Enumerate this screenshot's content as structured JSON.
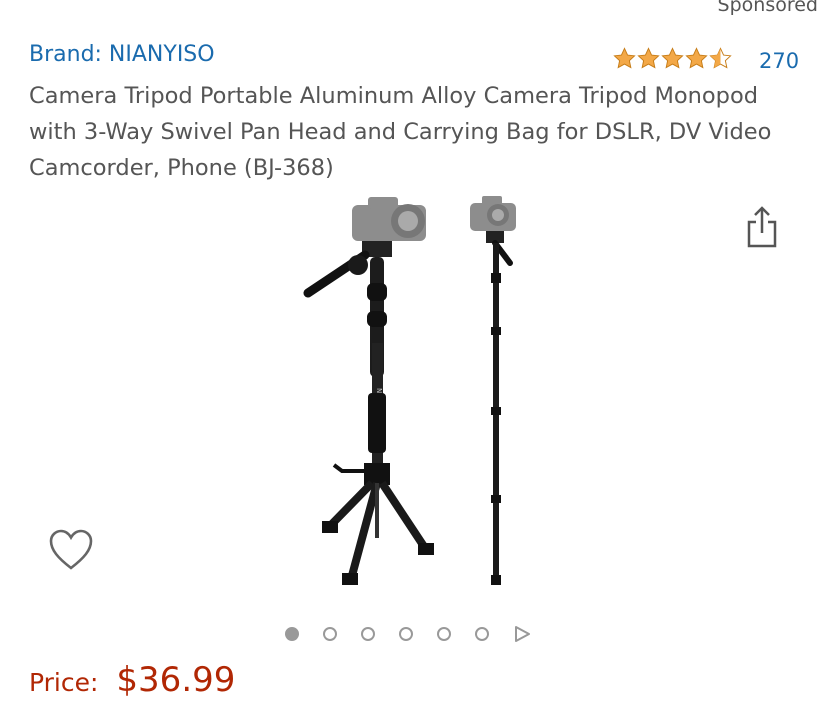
{
  "header": {
    "sponsored": "Sponsored"
  },
  "product": {
    "brand": "Brand: NIANYISO",
    "rating": {
      "stars": 4.5,
      "count": "270"
    },
    "title": "Camera Tripod Portable Aluminum Alloy Camera Tripod Monopod with 3-Way Swivel Pan Head and Carrying Bag for DSLR, DV Video Camcorder, Phone (BJ-368)",
    "price_label": "Price:",
    "price": "$36.99"
  },
  "gallery": {
    "image_count": 6,
    "active_index": 0,
    "has_video": true
  },
  "colors": {
    "link": "#1a6bae",
    "price": "#b12704",
    "star": "#f3a847"
  }
}
